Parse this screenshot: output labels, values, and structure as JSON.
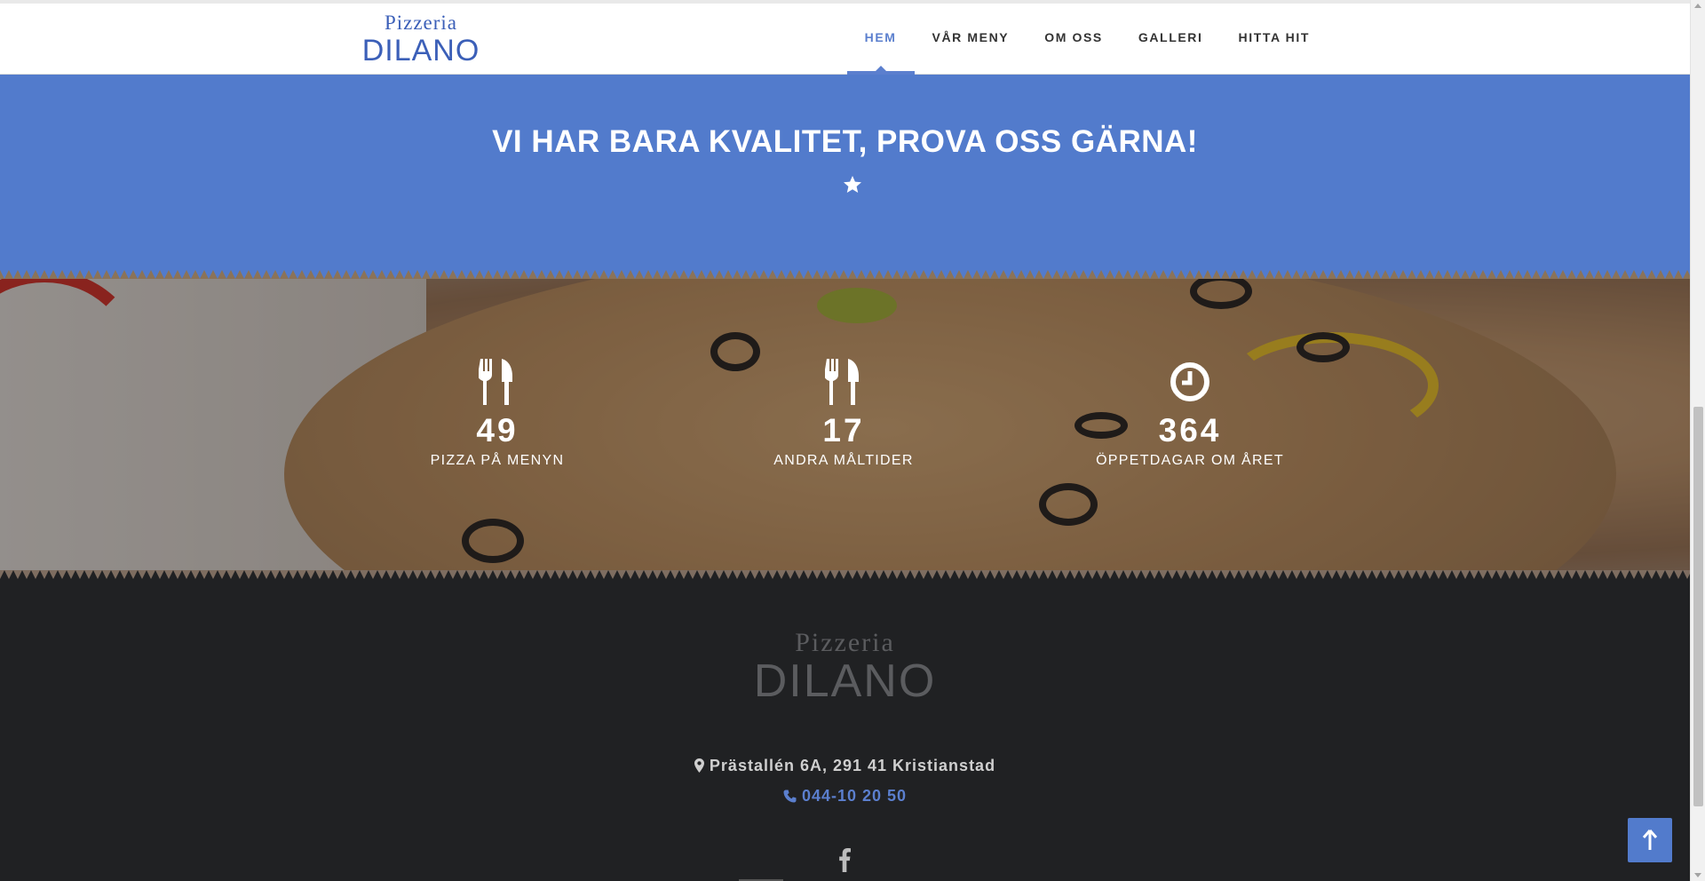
{
  "header": {
    "logo_line1": "Pizzeria",
    "logo_line2": "DILANO",
    "nav": [
      {
        "label": "HEM",
        "active": true
      },
      {
        "label": "VÅR MENY",
        "active": false
      },
      {
        "label": "OM OSS",
        "active": false
      },
      {
        "label": "GALLERI",
        "active": false
      },
      {
        "label": "HITTA HIT",
        "active": false
      }
    ]
  },
  "hero_band": {
    "heading": "VI HAR BARA KVALITET, PROVA OSS GÄRNA!",
    "icon": "star-icon"
  },
  "stats": [
    {
      "icon": "utensils-icon",
      "value": "49",
      "label": "PIZZA PÅ MENYN"
    },
    {
      "icon": "utensils-icon",
      "value": "17",
      "label": "ANDRA MÅLTIDER"
    },
    {
      "icon": "clock-icon",
      "value": "364",
      "label": "ÖPPETDAGAR OM ÅRET"
    }
  ],
  "footer": {
    "logo_line1": "Pizzeria",
    "logo_line2": "DILANO",
    "address": "Prästallén 6A, 291 41 Kristianstad",
    "phone": "044-10 20 50",
    "social_icon": "facebook-icon"
  },
  "colors": {
    "brand_blue": "#527bcc",
    "nav_active": "#5b7fce",
    "footer_bg": "#202123"
  }
}
